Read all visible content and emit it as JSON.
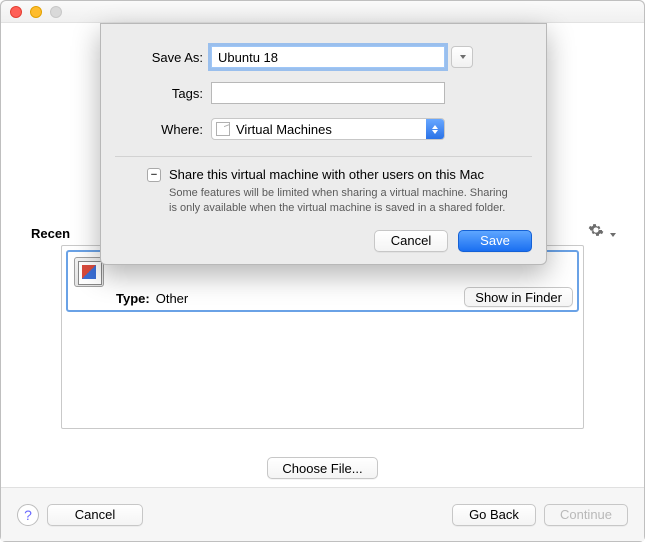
{
  "sheet": {
    "save_as_label": "Save As:",
    "save_as_value": "Ubuntu 18",
    "tags_label": "Tags:",
    "tags_value": "",
    "where_label": "Where:",
    "where_value": "Virtual Machines",
    "share_checkbox_glyph": "−",
    "share_label": "Share this virtual machine with other users on this Mac",
    "share_detail": "Some features will be limited when sharing a virtual machine. Sharing is only available when the virtual machine is saved in a shared folder.",
    "cancel": "Cancel",
    "save": "Save"
  },
  "recent": {
    "label": "Recen",
    "type_label": "Type:",
    "type_value": "Other",
    "show_in_finder": "Show in Finder"
  },
  "main": {
    "choose_file": "Choose File...",
    "help_glyph": "?",
    "cancel": "Cancel",
    "go_back": "Go Back",
    "continue": "Continue"
  }
}
